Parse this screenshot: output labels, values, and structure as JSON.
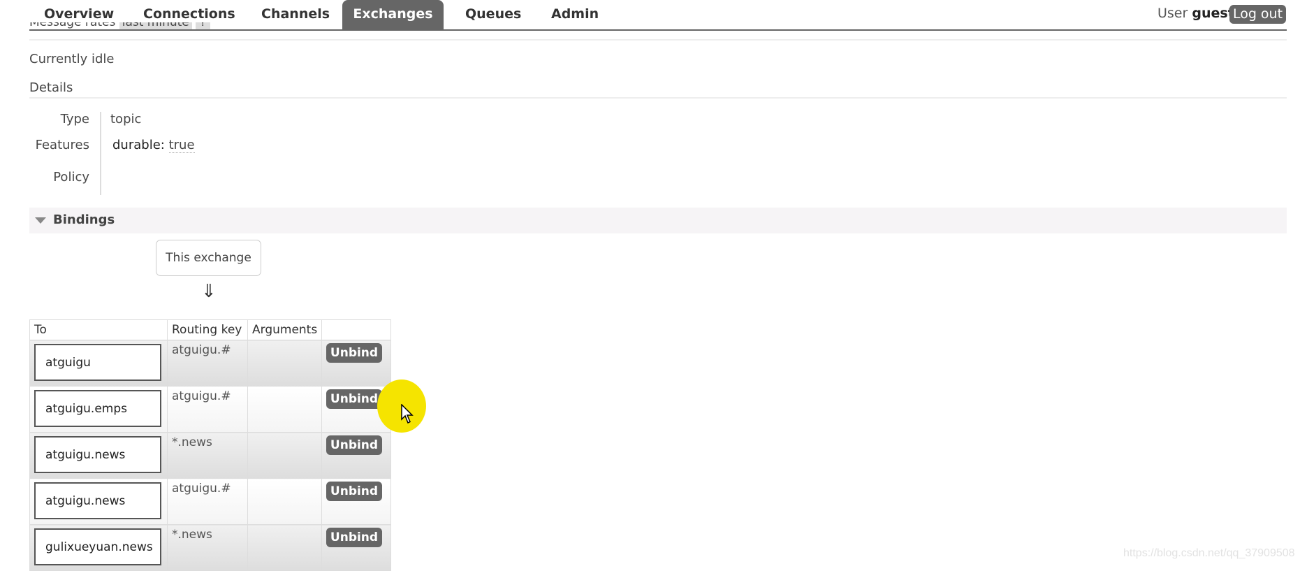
{
  "nav": {
    "tabs": [
      {
        "label": "Overview"
      },
      {
        "label": "Connections"
      },
      {
        "label": "Channels"
      },
      {
        "label": "Exchanges",
        "active": true
      },
      {
        "label": "Queues"
      },
      {
        "label": "Admin"
      }
    ],
    "user_label": "User",
    "user_name": "guest",
    "logout_label": "Log out"
  },
  "message_rates": {
    "label": "Message rates",
    "value": "last minute",
    "help": "?"
  },
  "status": "Currently idle",
  "details": {
    "heading": "Details",
    "type_label": "Type",
    "type_value": "topic",
    "features_label": "Features",
    "features_key": "durable:",
    "features_value": "true",
    "policy_label": "Policy"
  },
  "bindings": {
    "heading": "Bindings",
    "this_exchange": "This exchange",
    "arrow": "⇓",
    "columns": [
      "To",
      "Routing key",
      "Arguments",
      ""
    ],
    "rows": [
      {
        "to": "atguigu",
        "routing_key": "atguigu.#",
        "arguments": "",
        "action": "Unbind"
      },
      {
        "to": "atguigu.emps",
        "routing_key": "atguigu.#",
        "arguments": "",
        "action": "Unbind"
      },
      {
        "to": "atguigu.news",
        "routing_key": "*.news",
        "arguments": "",
        "action": "Unbind"
      },
      {
        "to": "atguigu.news",
        "routing_key": "atguigu.#",
        "arguments": "",
        "action": "Unbind"
      },
      {
        "to": "gulixueyuan.news",
        "routing_key": "*.news",
        "arguments": "",
        "action": "Unbind"
      }
    ]
  },
  "watermark": "https://blog.csdn.net/qq_37909508",
  "colors": {
    "nav_active": "#666666",
    "button": "#666666",
    "cursor_highlight": "#f5e400"
  }
}
